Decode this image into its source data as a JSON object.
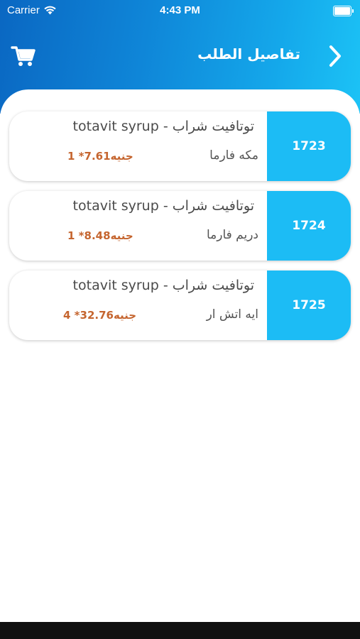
{
  "status_bar": {
    "carrier": "Carrier",
    "time": "4:43 PM",
    "battery_level": 1.0
  },
  "header": {
    "title": "تفاصيل الطلب",
    "back_icon": "chevron-right-icon",
    "cart_icon": "cart-icon"
  },
  "colors": {
    "header_gradient_start": "#0a67c2",
    "header_gradient_end": "#1cc3f6",
    "card_accent": "#1cbcf5",
    "price_color": "#c5652f"
  },
  "order_items": [
    {
      "number": "1723",
      "product": "توتافيت شراب - totavit syrup",
      "company": "مكه فارما",
      "price": "1 *7.61جنيه"
    },
    {
      "number": "1724",
      "product": "توتافيت شراب - totavit syrup",
      "company": "دريم فارما",
      "price": "1 *8.48جنيه"
    },
    {
      "number": "1725",
      "product": "توتافيت شراب - totavit syrup",
      "company": "ايه اتش ار",
      "price": "4 *32.76جنيه"
    }
  ]
}
